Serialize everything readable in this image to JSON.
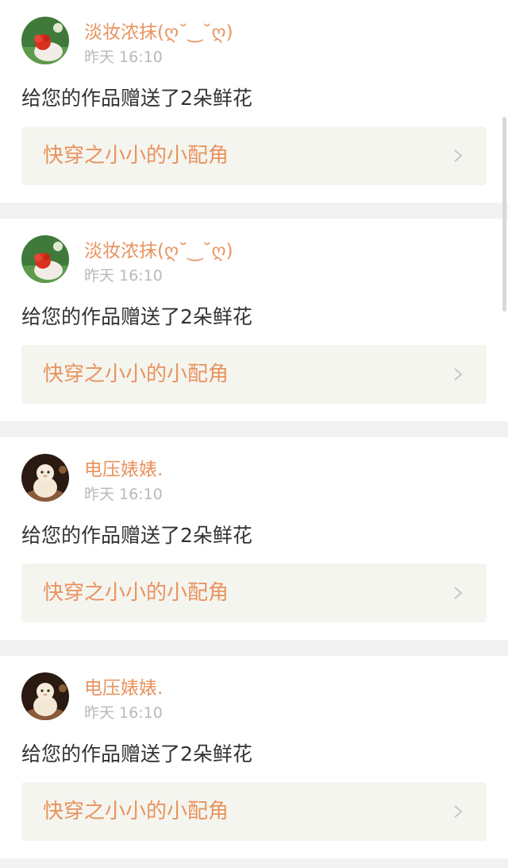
{
  "notifications": [
    {
      "username": "淡妆浓抹(ღ˘‿˘ღ)",
      "time": "昨天 16:10",
      "message": "给您的作品赠送了2朵鲜花",
      "work_title": "快穿之小小的小配角",
      "avatar": "flower-avatar"
    },
    {
      "username": "淡妆浓抹(ღ˘‿˘ღ)",
      "time": "昨天 16:10",
      "message": "给您的作品赠送了2朵鲜花",
      "work_title": "快穿之小小的小配角",
      "avatar": "flower-avatar"
    },
    {
      "username": "电压婊婊.",
      "time": "昨天 16:10",
      "message": "给您的作品赠送了2朵鲜花",
      "work_title": "快穿之小小的小配角",
      "avatar": "figurine-avatar"
    },
    {
      "username": "电压婊婊.",
      "time": "昨天 16:10",
      "message": "给您的作品赠送了2朵鲜花",
      "work_title": "快穿之小小的小配角",
      "avatar": "figurine-avatar"
    }
  ],
  "colors": {
    "accent": "#e8935f",
    "background": "#f2f2f2",
    "card": "#ffffff",
    "link_bg": "#f5f5ef",
    "meta_text": "#b9b9b9",
    "body_text": "#333333"
  }
}
